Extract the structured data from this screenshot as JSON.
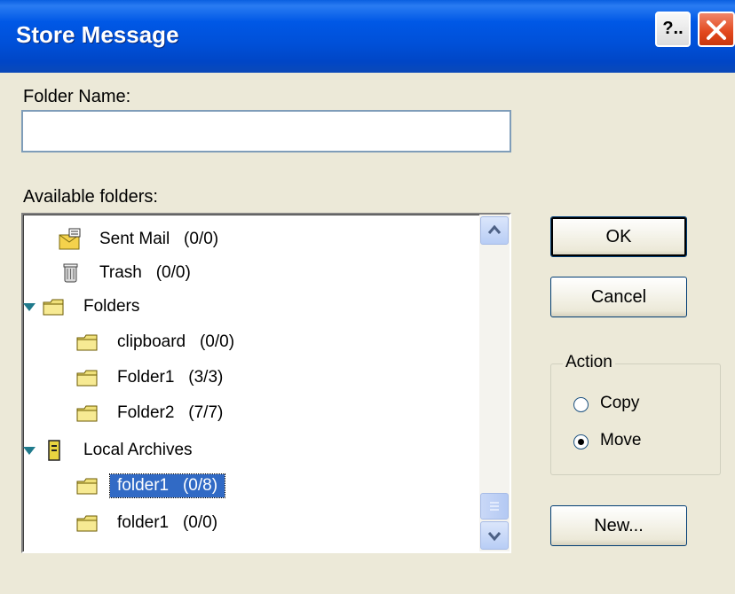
{
  "window": {
    "title": "Store Message",
    "help_label": "?.."
  },
  "folder_name": {
    "label": "Folder Name:",
    "value": ""
  },
  "available_folders": {
    "label": "Available folders:",
    "items": [
      {
        "name": "Sent Mail",
        "count": "(0/0)",
        "icon": "sent-mail-icon"
      },
      {
        "name": "Trash",
        "count": "(0/0)",
        "icon": "trash-icon"
      },
      {
        "name": "Folders",
        "count": "",
        "icon": "folder-icon",
        "expanded": true
      },
      {
        "name": "clipboard",
        "count": "(0/0)",
        "icon": "folder-icon"
      },
      {
        "name": "Folder1",
        "count": "(3/3)",
        "icon": "folder-icon"
      },
      {
        "name": "Folder2",
        "count": "(7/7)",
        "icon": "folder-icon"
      },
      {
        "name": "Local Archives",
        "count": "",
        "icon": "archive-icon",
        "expanded": true
      },
      {
        "name": "folder1",
        "count": "(0/8)",
        "icon": "folder-icon",
        "selected": true
      },
      {
        "name": "folder1",
        "count": "(0/0)",
        "icon": "folder-icon"
      }
    ]
  },
  "buttons": {
    "ok": "OK",
    "cancel": "Cancel",
    "new": "New..."
  },
  "action": {
    "title": "Action",
    "copy": "Copy",
    "move": "Move",
    "selected": "Move"
  }
}
